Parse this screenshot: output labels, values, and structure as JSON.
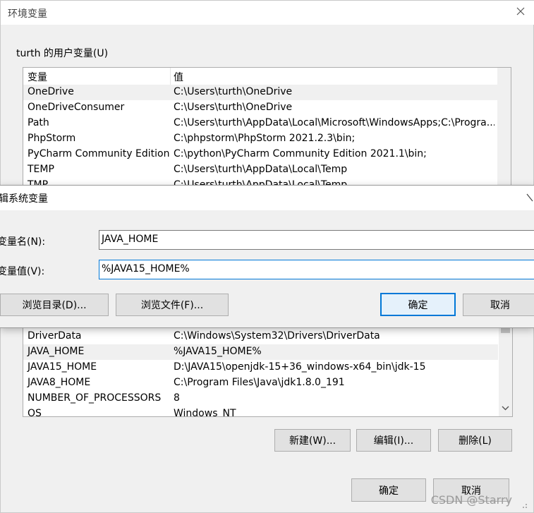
{
  "env_window": {
    "title": "环境变量",
    "user_group_label": "turth 的用户变量(U)",
    "columns": {
      "name": "变量",
      "value": "值"
    },
    "user_vars": [
      {
        "name": "OneDrive",
        "value": "C:\\Users\\turth\\OneDrive"
      },
      {
        "name": "OneDriveConsumer",
        "value": "C:\\Users\\turth\\OneDrive"
      },
      {
        "name": "Path",
        "value": "C:\\Users\\turth\\AppData\\Local\\Microsoft\\WindowsApps;C:\\Progra..."
      },
      {
        "name": "PhpStorm",
        "value": "C:\\phpstorm\\PhpStorm 2021.2.3\\bin;"
      },
      {
        "name": "PyCharm Community Edition",
        "value": "C:\\python\\PyCharm Community Edition 2021.1\\bin;"
      },
      {
        "name": "TEMP",
        "value": "C:\\Users\\turth\\AppData\\Local\\Temp"
      },
      {
        "name": "TMP",
        "value": "C:\\Users\\turth\\AppData\\Local\\Temp"
      }
    ],
    "system_vars": [
      {
        "name": "DriverData",
        "value": "C:\\Windows\\System32\\Drivers\\DriverData"
      },
      {
        "name": "JAVA_HOME",
        "value": "%JAVA15_HOME%"
      },
      {
        "name": "JAVA15_HOME",
        "value": "D:\\JAVA15\\openjdk-15+36_windows-x64_bin\\jdk-15"
      },
      {
        "name": "JAVA8_HOME",
        "value": "C:\\Program Files\\Java\\jdk1.8.0_191"
      },
      {
        "name": "NUMBER_OF_PROCESSORS",
        "value": "8"
      },
      {
        "name": "OS",
        "value": "Windows_NT"
      }
    ],
    "buttons": {
      "new": "新建(W)...",
      "edit": "编辑(I)...",
      "delete": "删除(L)",
      "ok": "确定",
      "cancel": "取消"
    }
  },
  "edit_dialog": {
    "title": "辑系统变量",
    "name_label": "变量名(N):",
    "value_label": "变量值(V):",
    "name_value": "JAVA_HOME",
    "value_value": "%JAVA15_HOME%",
    "browse_dir": "浏览目录(D)...",
    "browse_file": "浏览文件(F)...",
    "ok": "确定",
    "cancel": "取消"
  },
  "watermark": "CSDN @Starry",
  "icons": [
    "close-icon",
    "scroll-up-icon",
    "scroll-down-icon",
    "resize-grip-icon"
  ],
  "colors": {
    "focus_border": "#0078d7",
    "selected_row": "#f0f0f0",
    "button_face": "#e1e1e1"
  }
}
